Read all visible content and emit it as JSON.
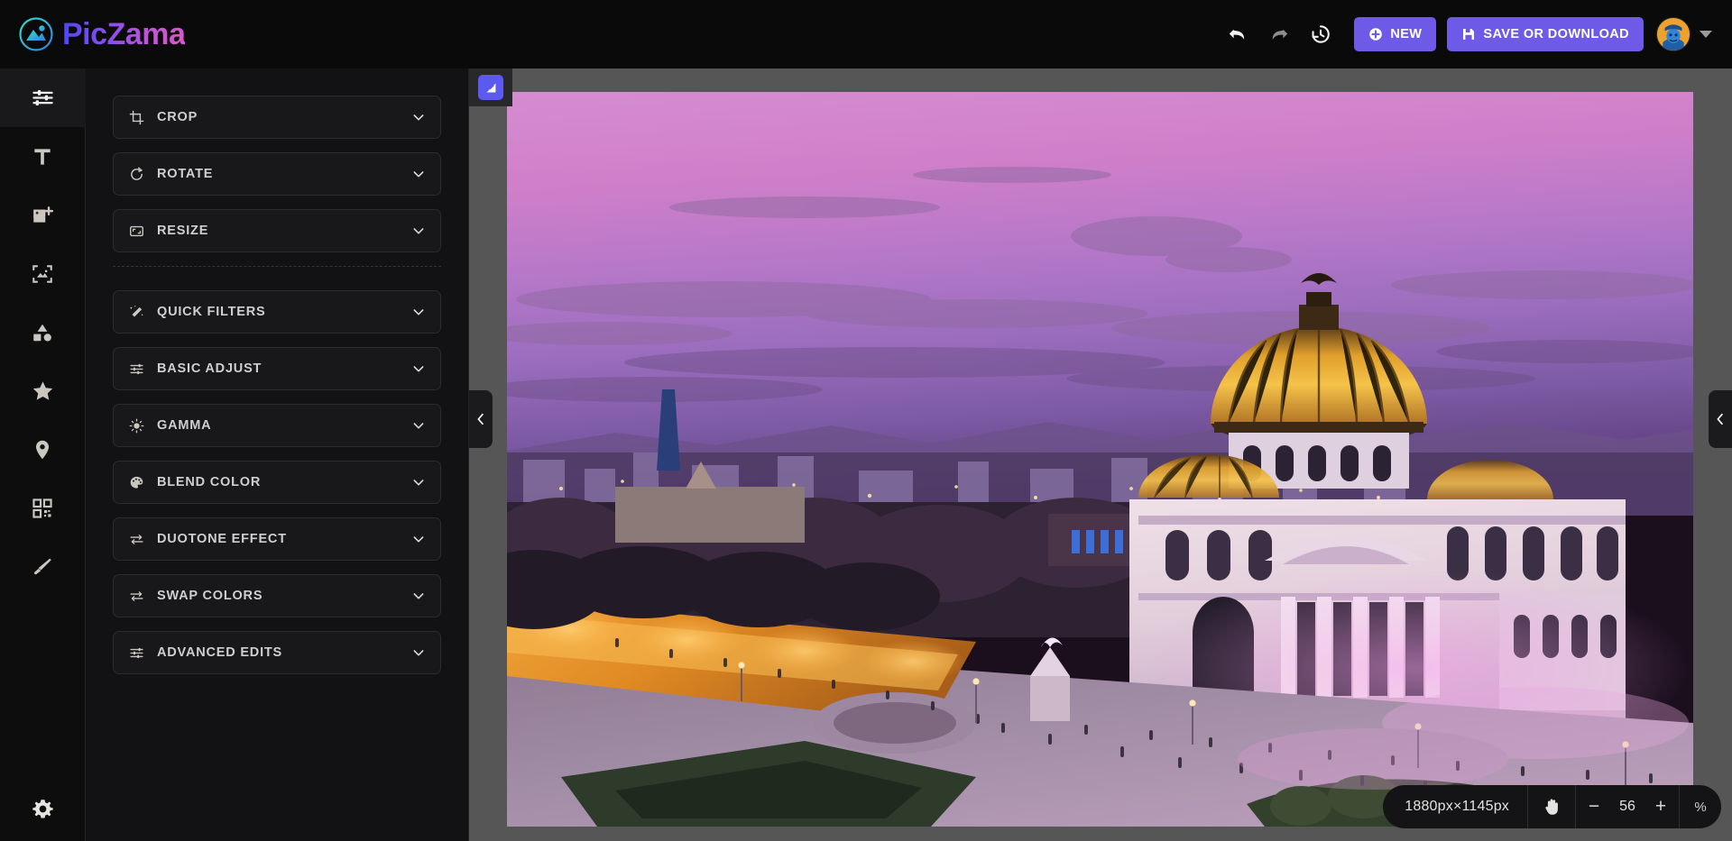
{
  "app": {
    "brand_name": "PicZama",
    "logo_icon": "image-circle-logo-icon"
  },
  "topbar": {
    "undo_icon": "undo-icon",
    "redo_icon": "redo-icon",
    "history_icon": "history-clock-icon",
    "new_label": "NEW",
    "new_icon": "plus-circle-icon",
    "save_label": "SAVE OR DOWNLOAD",
    "save_icon": "floppy-save-icon",
    "avatar_icon": "user-avatar",
    "caret_icon": "chevron-down-icon"
  },
  "rail": {
    "items": [
      {
        "name": "adjust",
        "icon": "sliders-icon",
        "active": true
      },
      {
        "name": "text",
        "icon": "text-t-icon",
        "active": false
      },
      {
        "name": "image",
        "icon": "add-image-icon",
        "active": false
      },
      {
        "name": "frame",
        "icon": "frame-image-icon",
        "active": false
      },
      {
        "name": "shapes",
        "icon": "shapes-icon",
        "active": false
      },
      {
        "name": "stickers",
        "icon": "star-icon",
        "active": false
      },
      {
        "name": "location",
        "icon": "map-pin-icon",
        "active": false
      },
      {
        "name": "elements",
        "icon": "grid-blocks-icon",
        "active": false
      },
      {
        "name": "draw",
        "icon": "paint-brush-icon",
        "active": false
      }
    ],
    "settings_icon": "gear-icon"
  },
  "panel": {
    "groups": [
      {
        "items": [
          {
            "label": "CROP",
            "icon": "crop-icon",
            "expanded": false
          },
          {
            "label": "ROTATE",
            "icon": "rotate-icon",
            "expanded": false
          },
          {
            "label": "RESIZE",
            "icon": "resize-icon",
            "expanded": false
          }
        ]
      },
      {
        "items": [
          {
            "label": "QUICK FILTERS",
            "icon": "magic-wand-icon",
            "expanded": false
          },
          {
            "label": "BASIC ADJUST",
            "icon": "sliders-icon",
            "expanded": false
          },
          {
            "label": "GAMMA",
            "icon": "brightness-icon",
            "expanded": false
          },
          {
            "label": "BLEND COLOR",
            "icon": "color-palette-icon",
            "expanded": false
          },
          {
            "label": "DUOTONE EFFECT",
            "icon": "swap-arrows-icon",
            "expanded": false
          },
          {
            "label": "SWAP COLORS",
            "icon": "swap-arrows-icon",
            "expanded": false
          },
          {
            "label": "ADVANCED EDITS",
            "icon": "sliders-icon",
            "expanded": false
          }
        ]
      }
    ],
    "chevron_icon": "chevron-down-icon"
  },
  "canvas": {
    "watermark_button_icon": "watermark-flag-icon",
    "image_description": "Palacio de Bellas Artes at dusk, Mexico City, purple and pink sky",
    "left_handle_icon": "chevron-left-icon",
    "right_handle_icon": "chevron-left-icon"
  },
  "zoombar": {
    "dimensions": "1880px×1145px",
    "pan_icon": "hand-pan-icon",
    "zoom_out_label": "−",
    "zoom_value": "56",
    "zoom_in_label": "+",
    "percent_label": "%"
  },
  "colors": {
    "accent": "#6d5ae6",
    "topbar_bg": "#0a0a0b",
    "panel_bg": "#121214",
    "rail_bg": "#0d0d0e",
    "canvas_bg": "#565656",
    "accordion_bg": "#18181b",
    "accordion_border": "#2c2c30",
    "text": "#cfcfcf",
    "brand_gradient_start": "#4f46f5",
    "brand_gradient_end": "#d957c9"
  }
}
